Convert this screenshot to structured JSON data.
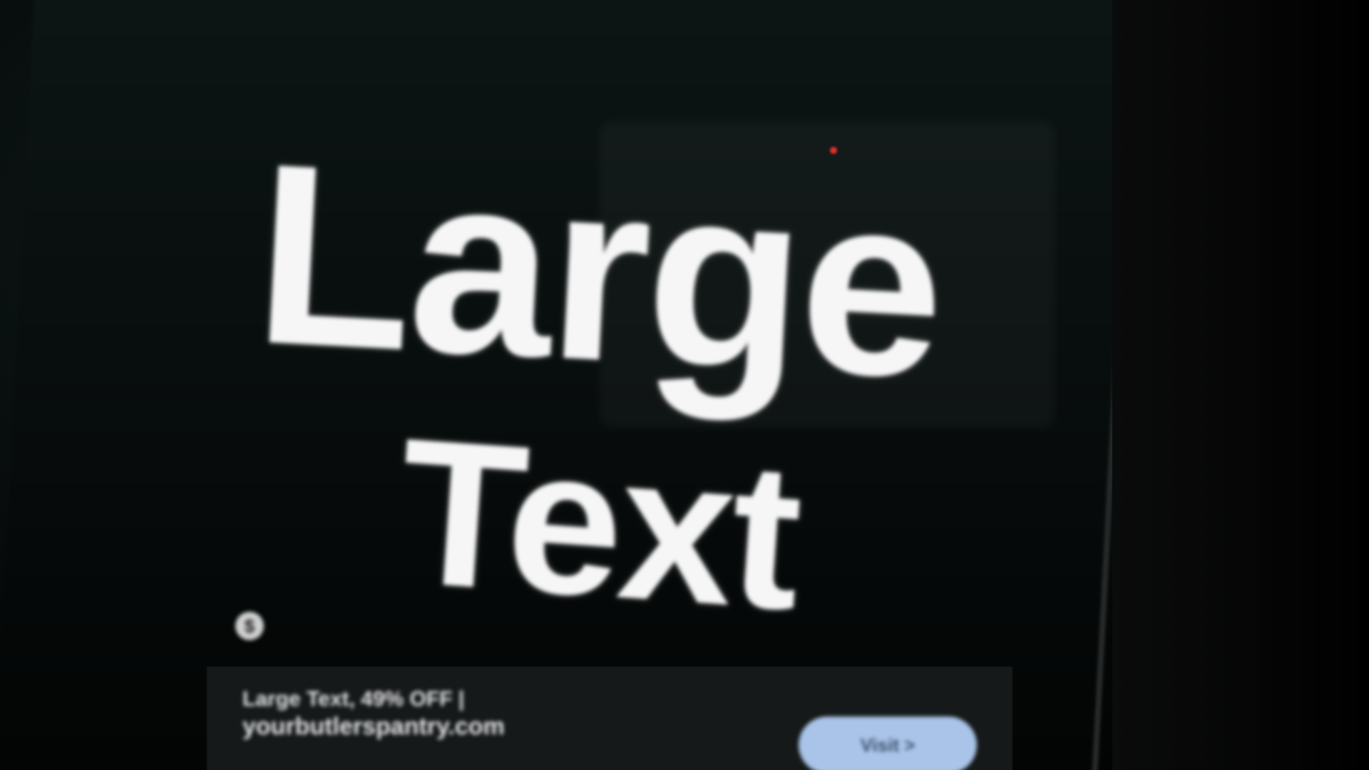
{
  "headline": {
    "line1": "Large",
    "line2": "Text"
  },
  "ad": {
    "icon": "sponsored-icon",
    "title": "Large Text, 49% OFF |",
    "domain": "yourbutlerspantry.com",
    "description": "",
    "button_label": "Visit >"
  },
  "colors": {
    "text": "#f6f6f6",
    "background": "#000000",
    "button": "#a9c4e8",
    "indicator": "#e0302a"
  }
}
